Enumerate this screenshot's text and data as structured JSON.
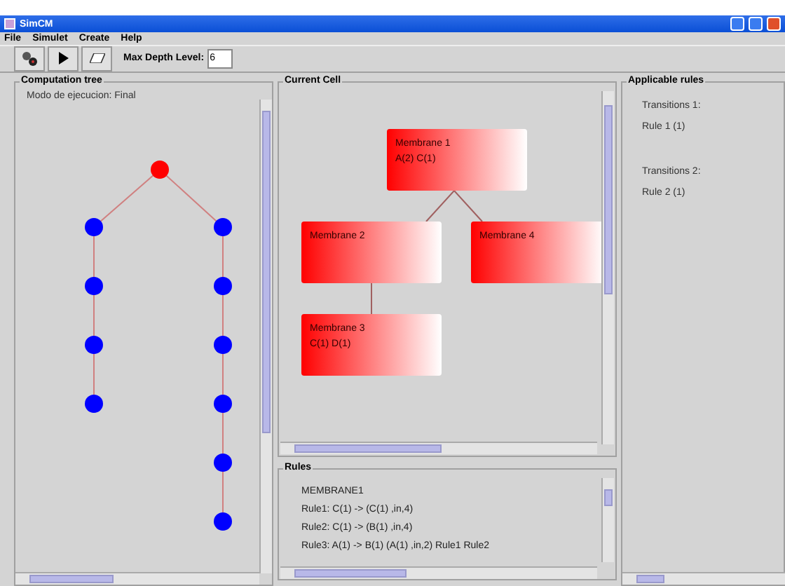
{
  "window": {
    "title": "SimCM"
  },
  "menu": [
    "File",
    "Simulet",
    "Create",
    "Help"
  ],
  "toolbar": {
    "depth_label": "Max Depth Level:",
    "depth_value": "6"
  },
  "computation_tree": {
    "title": "Computation tree",
    "mode": "Modo de ejecucion: Final",
    "root": {
      "color": "#ff0000",
      "children": [
        {
          "color": "#0000ff",
          "children": [
            {
              "color": "#0000ff",
              "children": [
                {
                  "color": "#0000ff",
                  "children": [
                    {
                      "color": "#0000ff"
                    }
                  ]
                }
              ]
            }
          ]
        },
        {
          "color": "#0000ff",
          "children": [
            {
              "color": "#0000ff",
              "children": [
                {
                  "color": "#0000ff",
                  "children": [
                    {
                      "color": "#0000ff",
                      "children": [
                        {
                          "color": "#0000ff",
                          "children": [
                            {
                              "color": "#0000ff"
                            }
                          ]
                        }
                      ]
                    }
                  ]
                }
              ]
            }
          ]
        }
      ]
    }
  },
  "current_cell": {
    "title": "Current Cell",
    "membrane": {
      "name": "Membrane 1",
      "content": "A(2) C(1)",
      "children": [
        {
          "name": "Membrane 2",
          "children": [
            {
              "name": "Membrane 3",
              "content": "C(1) D(1)"
            }
          ]
        },
        {
          "name": "Membrane 4"
        }
      ]
    }
  },
  "rules": {
    "title": "Rules",
    "lines": [
      "MEMBRANE1",
      "Rule1: C(1) -> (C(1) ,in,4)",
      "Rule2: C(1) -> (B(1) ,in,4)",
      "Rule3: A(1) -> B(1) (A(1) ,in,2)  Rule1 Rule2"
    ]
  },
  "applicable_rules": {
    "title": "Applicable rules",
    "groups": [
      {
        "heading": "Transitions 1:",
        "rule": "Rule 1  (1)"
      },
      {
        "heading": "Transitions 2:",
        "rule": "Rule 2  (1)"
      }
    ]
  }
}
